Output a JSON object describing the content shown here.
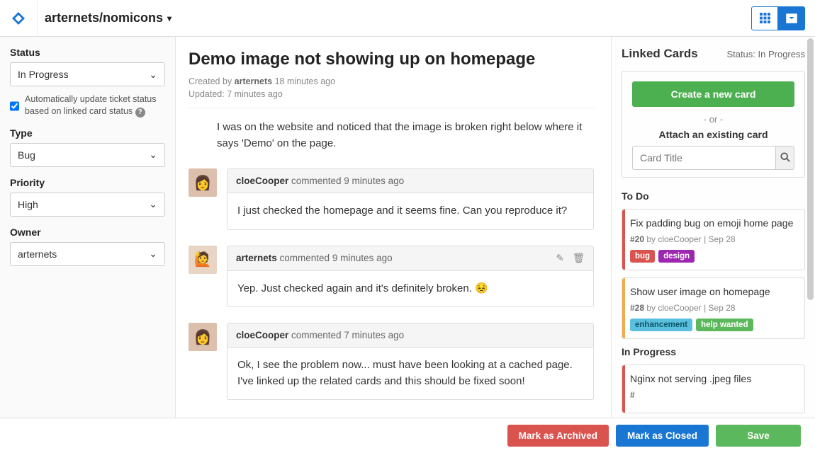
{
  "header": {
    "project": "arternets/nomicons"
  },
  "sidebar": {
    "status": {
      "label": "Status",
      "value": "In Progress"
    },
    "status_checkbox": "Automatically update ticket status based on linked card status",
    "type": {
      "label": "Type",
      "value": "Bug"
    },
    "priority": {
      "label": "Priority",
      "value": "High"
    },
    "owner": {
      "label": "Owner",
      "value": "arternets"
    }
  },
  "ticket": {
    "title": "Demo image not showing up on homepage",
    "created_by_prefix": "Created by ",
    "created_by": "arternets",
    "created_time": " 18 minutes ago",
    "updated": "Updated: 7 minutes ago",
    "body": "I was on the website and noticed that the image is broken right below where it says 'Demo' on the page."
  },
  "comments": [
    {
      "author": "cloeCooper",
      "time": " commented 9 minutes ago",
      "text": "I just checked the homepage and it seems fine. Can you reproduce it?",
      "editable": false
    },
    {
      "author": "arternets",
      "time": " commented 9 minutes ago",
      "text": "Yep. Just checked again and it's definitely broken. 😣",
      "editable": true
    },
    {
      "author": "cloeCooper",
      "time": " commented 7 minutes ago",
      "text": "Ok, I see the problem now... must have been looking at a cached page. I've linked up the related cards and this should be fixed soon!",
      "editable": false
    }
  ],
  "linked": {
    "title": "Linked Cards",
    "status": "Status: In Progress",
    "create_btn": "Create a new card",
    "or": "- or -",
    "attach_label": "Attach an existing card",
    "search_placeholder": "Card Title",
    "columns": [
      {
        "name": "To Do",
        "cards": [
          {
            "title": "Fix padding bug on emoji home page",
            "id": "#20",
            "meta": " by cloeCooper | Sep 28",
            "color": "red",
            "tags": [
              {
                "text": "bug",
                "cls": "bug"
              },
              {
                "text": "design",
                "cls": "design"
              }
            ]
          },
          {
            "title": "Show user image on homepage",
            "id": "#28",
            "meta": " by cloeCooper | Sep 28",
            "color": "orange",
            "tags": [
              {
                "text": "enhancement",
                "cls": "enhancement"
              },
              {
                "text": "help wanted",
                "cls": "help"
              }
            ]
          }
        ]
      },
      {
        "name": "In Progress",
        "cards": [
          {
            "title": "Nginx not serving .jpeg files",
            "id": "#",
            "meta": "",
            "color": "red",
            "tags": []
          }
        ]
      }
    ]
  },
  "footer": {
    "archive": "Mark as Archived",
    "close": "Mark as Closed",
    "save": "Save"
  }
}
